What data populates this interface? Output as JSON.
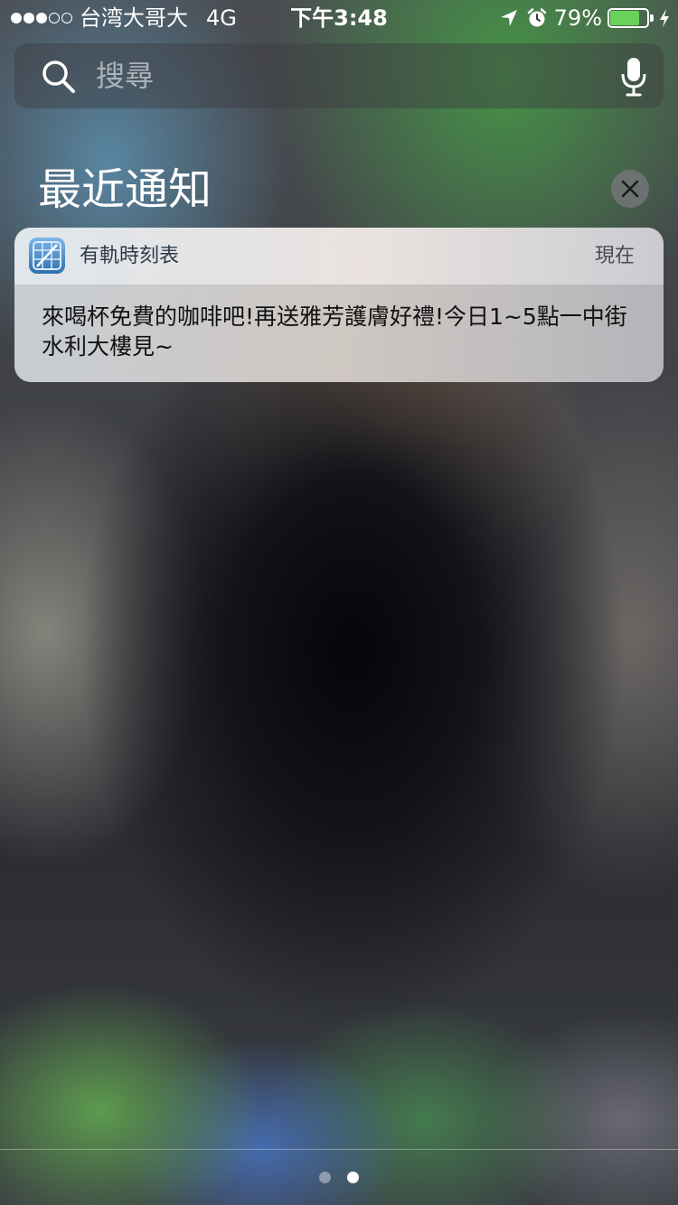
{
  "status_bar": {
    "signal_filled": 3,
    "signal_total": 5,
    "carrier": "台湾大哥大",
    "network": "4G",
    "time": "下午3:48",
    "battery_percent": "79%",
    "battery_level": 0.79,
    "icons": [
      "location-arrow-icon",
      "alarm-clock-icon",
      "battery-icon",
      "charging-bolt-icon"
    ]
  },
  "search": {
    "placeholder": "搜尋",
    "icons": [
      "search-icon",
      "microphone-icon"
    ]
  },
  "notifications_section": {
    "title": "最近通知",
    "clear_icon": "close-icon"
  },
  "notification": {
    "app_name": "有軌時刻表",
    "time": "現在",
    "message": "來喝杯免費的咖啡吧!再送雅芳護膚好禮!今日1~5點一中街水利大樓見~",
    "icon": "app-icon"
  },
  "pager": {
    "pages": 2,
    "current": 2
  },
  "colors": {
    "battery_fill": "#6ad15a",
    "card_text": "#111111",
    "app_name": "#2c3a48"
  }
}
